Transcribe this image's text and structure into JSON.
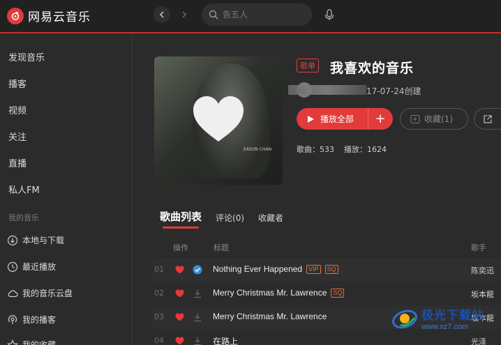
{
  "app": {
    "logo_text": "网易云音乐"
  },
  "search": {
    "placeholder": "告五人"
  },
  "sidebar": {
    "items": [
      {
        "label": "发现音乐"
      },
      {
        "label": "播客"
      },
      {
        "label": "视频"
      },
      {
        "label": "关注"
      },
      {
        "label": "直播"
      },
      {
        "label": "私人FM"
      }
    ],
    "section_title": "我的音乐",
    "my_music": [
      {
        "label": "本地与下载",
        "icon": "download-circle-icon"
      },
      {
        "label": "最近播放",
        "icon": "clock-icon"
      },
      {
        "label": "我的音乐云盘",
        "icon": "cloud-icon"
      },
      {
        "label": "我的播客",
        "icon": "podcast-icon"
      },
      {
        "label": "我的收藏",
        "icon": "star-icon"
      }
    ]
  },
  "playlist": {
    "badge": "歌单",
    "title": "我喜欢的音乐",
    "created": "17-07-24创建",
    "cover_text": "EASON CHAN",
    "play_all_label": "播放全部",
    "add_label": "+",
    "collect_label": "收藏(1)",
    "stats": {
      "songs": "歌曲：533",
      "plays": "播放：1624"
    }
  },
  "tabs": [
    {
      "label": "歌曲列表",
      "active": true
    },
    {
      "label": "评论(0)",
      "active": false
    },
    {
      "label": "收藏者",
      "active": false
    }
  ],
  "table": {
    "headers": {
      "ops": "操作",
      "title": "标题",
      "artist": "歌手"
    },
    "rows": [
      {
        "num": "01",
        "title": "Nothing Ever Happened",
        "tags": [
          "VIP",
          "SQ"
        ],
        "artist": "陈奕迅",
        "downloaded": true
      },
      {
        "num": "02",
        "title": "Merry Christmas Mr. Lawrence",
        "tags": [
          "SQ"
        ],
        "artist": "坂本龍",
        "downloaded": false
      },
      {
        "num": "03",
        "title": "Merry Christmas Mr. Lawrence",
        "tags": [],
        "artist": "坂本龍",
        "downloaded": false
      },
      {
        "num": "04",
        "title": "在路上",
        "tags": [],
        "artist": "光泽",
        "downloaded": false
      }
    ]
  },
  "watermark": {
    "name": "极光下载站",
    "url": "www.xz7.com"
  },
  "colors": {
    "accent": "#e33a3a",
    "background": "#2b2b2b",
    "topbar": "#212121",
    "quality_tag": "#e0743e"
  }
}
